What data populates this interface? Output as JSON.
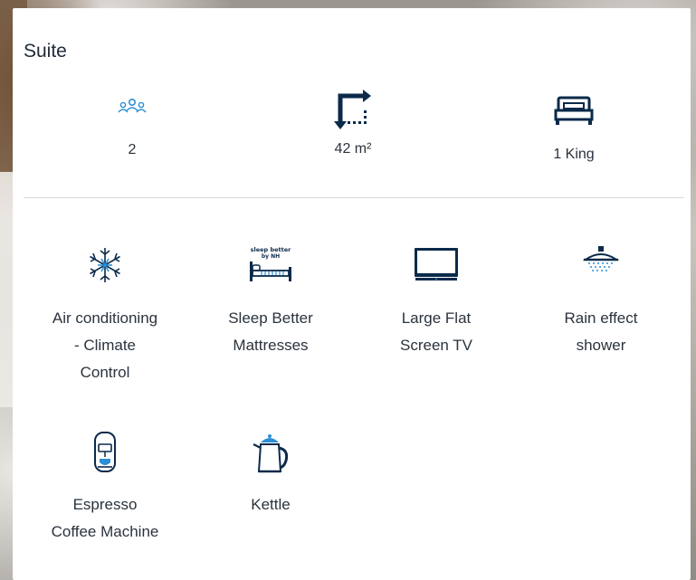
{
  "room": {
    "title": "Suite",
    "stats": [
      {
        "icon": "guests-icon",
        "value": "2"
      },
      {
        "icon": "room-size-icon",
        "value": "42 m²"
      },
      {
        "icon": "bed-icon",
        "value": "1 King"
      }
    ]
  },
  "amenities": [
    {
      "icon": "snowflake-icon",
      "label_lines": [
        "Air conditioning",
        "- Climate",
        "Control"
      ]
    },
    {
      "icon": "mattress-icon",
      "badge_lines": [
        "sleep better",
        "by NH"
      ],
      "label_lines": [
        "Sleep Better",
        "Mattresses"
      ]
    },
    {
      "icon": "tv-icon",
      "label_lines": [
        "Large Flat",
        "Screen TV"
      ]
    },
    {
      "icon": "shower-icon",
      "label_lines": [
        "Rain effect",
        "shower"
      ]
    },
    {
      "icon": "espresso-icon",
      "label_lines": [
        "Espresso",
        "Coffee Machine"
      ]
    },
    {
      "icon": "kettle-icon",
      "label_lines": [
        "Kettle"
      ]
    }
  ],
  "colors": {
    "icon": "#0b2a4a",
    "accent": "#2a8fd6",
    "text": "#2a333d",
    "divider": "#d6d9dc"
  }
}
